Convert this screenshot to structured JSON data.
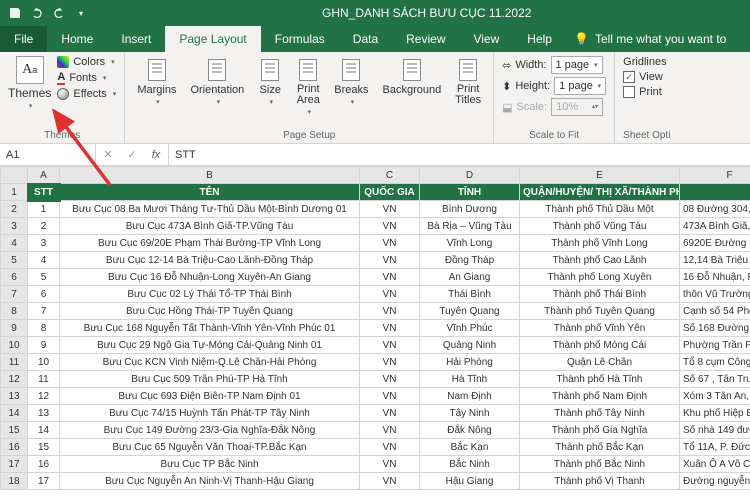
{
  "titlebar": {
    "filename": "GHN_DANH SÁCH BƯU CỤC 11.2022"
  },
  "tabs": {
    "file": "File",
    "home": "Home",
    "insert": "Insert",
    "pagelayout": "Page Layout",
    "formulas": "Formulas",
    "data": "Data",
    "review": "Review",
    "view": "View",
    "help": "Help",
    "tellme": "Tell me what you want to"
  },
  "ribbon": {
    "themes": {
      "themes": "Themes",
      "colors": "Colors",
      "fonts": "Fonts",
      "effects": "Effects",
      "group": "Themes"
    },
    "page_setup": {
      "margins": "Margins",
      "orientation": "Orientation",
      "size": "Size",
      "print_area": "Print\nArea",
      "breaks": "Breaks",
      "background": "Background",
      "print_titles": "Print\nTitles",
      "group": "Page Setup"
    },
    "scale": {
      "width": "Width:",
      "width_val": "1 page",
      "height": "Height:",
      "height_val": "1 page",
      "scale": "Scale:",
      "scale_val": "10%",
      "group": "Scale to Fit"
    },
    "sheet": {
      "gridlines": "Gridlines",
      "view": "View",
      "print": "Print",
      "group": "Sheet Opti"
    }
  },
  "formula_bar": {
    "name_box": "A1",
    "fx": "fx",
    "value": "STT"
  },
  "columns": [
    "A",
    "B",
    "C",
    "D",
    "E",
    "F"
  ],
  "headers": {
    "stt": "STT",
    "ten": "TÊN",
    "qg": "QUỐC GIA",
    "tinh": "TỈNH",
    "quan": "QUẬN/HUYỆN/ THỊ XÃ/THÀNH PHỐ",
    "dc": ""
  },
  "rows": [
    {
      "n": "1",
      "ten": "Bưu Cục 08 Ba Mươi Tháng Tư-Thủ Dầu Một-Bình Dương 01",
      "qg": "VN",
      "tinh": "Bình Dương",
      "quan": "Thành phố Thủ Dầu Một",
      "dc": "08 Đường 304, p"
    },
    {
      "n": "2",
      "ten": "Bưu Cục 473A Bình Giã-TP.Vũng Tàu",
      "qg": "VN",
      "tinh": "Bà Rịa – Vũng Tàu",
      "quan": "Thành phố Vũng Tàu",
      "dc": "473A Bình Giã, P"
    },
    {
      "n": "3",
      "ten": "Bưu Cục 69/20E Phạm Thái Bường-TP Vĩnh Long",
      "qg": "VN",
      "tinh": "Vĩnh Long",
      "quan": "Thành phố Vĩnh Long",
      "dc": "6920E Đường Ph"
    },
    {
      "n": "4",
      "ten": "Bưu Cục 12-14 Bà Triệu-Cao Lãnh-Đồng Tháp",
      "qg": "VN",
      "tinh": "Đồng Tháp",
      "quan": "Thành phố Cao Lãnh",
      "dc": "12,14 Bà Triệu K"
    },
    {
      "n": "5",
      "ten": "Bưu Cục 16 Đỗ Nhuận-Long Xuyên-An Giang",
      "qg": "VN",
      "tinh": "An Giang",
      "quan": "Thành phố Long Xuyên",
      "dc": "16 Đỗ Nhuận, Ph"
    },
    {
      "n": "6",
      "ten": "Bưu Cục 02 Lý Thái Tổ-TP Thái Bình",
      "qg": "VN",
      "tinh": "Thái Bình",
      "quan": "Thành phố Thái Bình",
      "dc": "thôn Vũ Trường,"
    },
    {
      "n": "7",
      "ten": "Bưu Cục Hồng Thái-TP Tuyên Quang",
      "qg": "VN",
      "tinh": "Tuyên Quang",
      "quan": "Thành phố Tuyên Quang",
      "dc": "Cạnh số 54 Phố"
    },
    {
      "n": "8",
      "ten": "Bưu Cục 168 Nguyễn Tất Thành-Vĩnh Yên-Vĩnh Phúc 01",
      "qg": "VN",
      "tinh": "Vĩnh Phúc",
      "quan": "Thành phố Vĩnh Yên",
      "dc": "Số 168 Đường N"
    },
    {
      "n": "9",
      "ten": "Bưu Cục 29 Ngô Gia Tự-Móng Cái-Quảng Ninh 01",
      "qg": "VN",
      "tinh": "Quảng Ninh",
      "quan": "Thành phố Móng Cái",
      "dc": "Phường Trần Ph"
    },
    {
      "n": "10",
      "ten": "Bưu Cục KCN Vinh Niệm-Q.Lê Chân-Hải Phòng",
      "qg": "VN",
      "tinh": "Hải Phòng",
      "quan": "Quận Lê Chân",
      "dc": "Tổ 8 cụm Công"
    },
    {
      "n": "11",
      "ten": "Bưu Cục 509 Trần Phú-TP Hà Tĩnh",
      "qg": "VN",
      "tinh": "Hà Tĩnh",
      "quan": "Thành phố Hà Tĩnh",
      "dc": "Số 67 , Tân Trun"
    },
    {
      "n": "12",
      "ten": "Bưu Cục 693 Điện Biên-TP Nam Định 01",
      "qg": "VN",
      "tinh": "Nam Định",
      "quan": "Thành phố Nam Định",
      "dc": "Xóm 3 Tân An, l"
    },
    {
      "n": "13",
      "ten": "Bưu Cục 74/15 Huỳnh Tấn Phát-TP Tây Ninh",
      "qg": "VN",
      "tinh": "Tây Ninh",
      "quan": "Thành phố Tây Ninh",
      "dc": "Khu phố Hiệp Bì"
    },
    {
      "n": "14",
      "ten": "Bưu Cục 149 Đường 23/3-Gia Nghĩa-Đắk Nông",
      "qg": "VN",
      "tinh": "Đắk Nông",
      "quan": "Thành phố Gia Nghĩa",
      "dc": "Số nhà 149 đườ"
    },
    {
      "n": "15",
      "ten": "Bưu Cục 65 Nguyễn Văn Thoại-TP.Bắc Kạn",
      "qg": "VN",
      "tinh": "Bắc Kạn",
      "quan": "Thành phố Bắc Kạn",
      "dc": "Tổ 11A, P. Đức"
    },
    {
      "n": "16",
      "ten": "Bưu Cục TP Bắc Ninh",
      "qg": "VN",
      "tinh": "Bắc Ninh",
      "quan": "Thành phố Bắc Ninh",
      "dc": "Xuân Ô A Võ Cư"
    },
    {
      "n": "17",
      "ten": "Bưu Cục Nguyễn An Ninh-Vị Thanh-Hậu Giang",
      "qg": "VN",
      "tinh": "Hậu Giang",
      "quan": "Thành phố Vị Thanh",
      "dc": "Đường nguyễn a"
    }
  ]
}
